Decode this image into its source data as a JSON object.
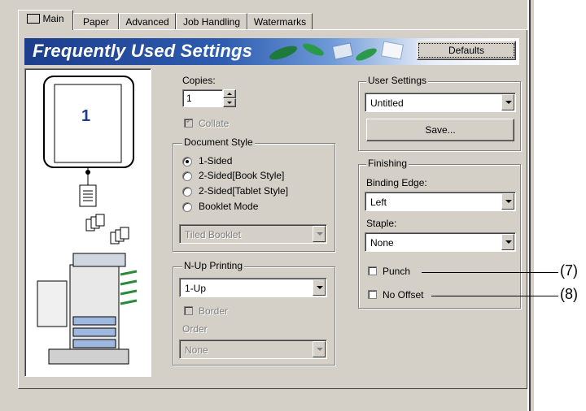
{
  "tabs": [
    {
      "label": "Main"
    },
    {
      "label": "Paper"
    },
    {
      "label": "Advanced"
    },
    {
      "label": "Job Handling"
    },
    {
      "label": "Watermarks"
    }
  ],
  "banner": {
    "title": "Frequently Used Settings",
    "defaults_label": "Defaults"
  },
  "preview": {
    "page_number": "1"
  },
  "copies": {
    "label": "Copies:",
    "value": "1"
  },
  "collate": {
    "label": "Collate",
    "checked": true
  },
  "document_style": {
    "label": "Document Style",
    "options": [
      "1-Sided",
      "2-Sided[Book Style]",
      "2-Sided[Tablet Style]",
      "Booklet Mode"
    ],
    "selected": "1-Sided",
    "booklet_select": "Tiled Booklet"
  },
  "nup": {
    "label": "N-Up Printing",
    "value": "1-Up",
    "border_label": "Border",
    "order_label": "Order",
    "order_value": "None"
  },
  "user_settings": {
    "label": "User Settings",
    "value": "Untitled",
    "save_label": "Save..."
  },
  "finishing": {
    "label": "Finishing",
    "binding_edge_label": "Binding Edge:",
    "binding_edge_value": "Left",
    "staple_label": "Staple:",
    "staple_value": "None",
    "punch_label": "Punch",
    "no_offset_label": "No Offset"
  },
  "callouts": {
    "punch": "(7)",
    "no_offset": "(8)"
  }
}
